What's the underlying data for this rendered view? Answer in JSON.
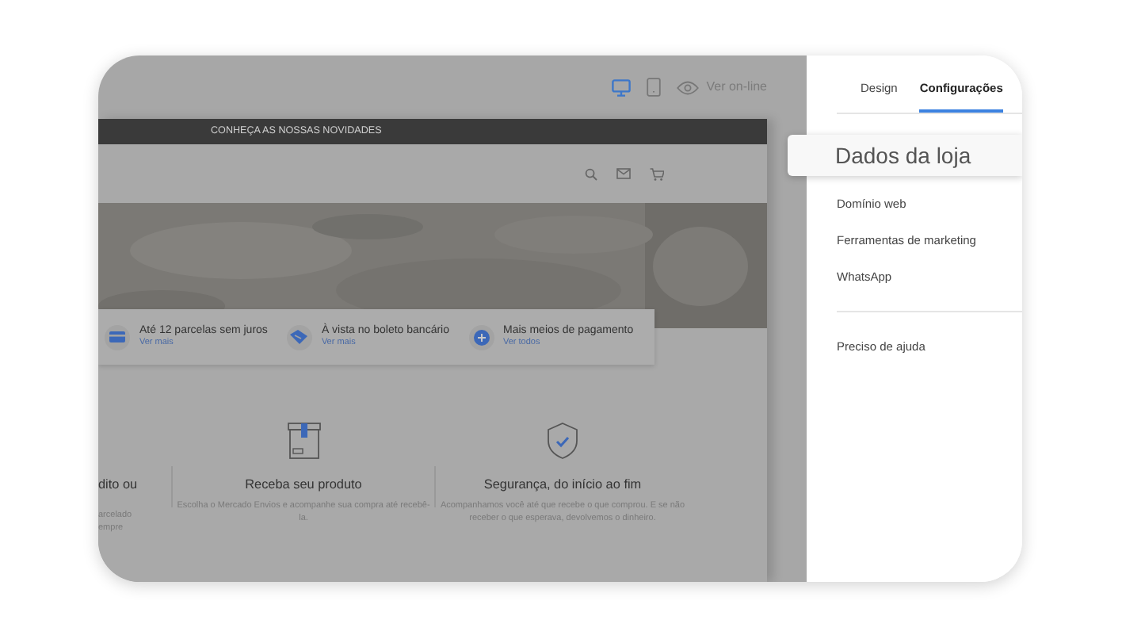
{
  "toolbar": {
    "devices": [
      {
        "kind": "desktop",
        "selected": true
      },
      {
        "kind": "mobile",
        "selected": false
      }
    ],
    "preview_link": "Ver on-line"
  },
  "store": {
    "announcement": "CONHEÇA AS NOSSAS NOVIDADES",
    "payments": [
      {
        "kind": "card",
        "title": "Até 12 parcelas sem juros",
        "link": "Ver mais"
      },
      {
        "kind": "boleto",
        "title": "À vista no boleto bancário",
        "link": "Ver mais"
      },
      {
        "kind": "plus",
        "title": "Mais meios de pagamento",
        "link": "Ver todos"
      }
    ],
    "features": [
      {
        "kind": "none",
        "title": "dito ou",
        "text": "arcelado\nempre"
      },
      {
        "kind": "box",
        "title": "Receba seu produto",
        "text": "Escolha o Mercado Envios e acompanhe sua compra até recebê-la."
      },
      {
        "kind": "shield",
        "title": "Segurança, do início ao fim",
        "text": "Acompanhamos você até que recebe o que comprou. E se não receber o que esperava, devolvemos o dinheiro."
      }
    ]
  },
  "sidebar": {
    "tabs": [
      {
        "label": "Design",
        "selected": false
      },
      {
        "label": "Configurações",
        "selected": true
      }
    ],
    "items": [
      {
        "label": "Dados da loja",
        "selected": true
      },
      {
        "label": "Domínio web",
        "selected": false
      },
      {
        "label": "Ferramentas de marketing",
        "selected": false
      },
      {
        "label": "WhatsApp",
        "selected": false
      }
    ],
    "help": "Preciso de ajuda"
  }
}
